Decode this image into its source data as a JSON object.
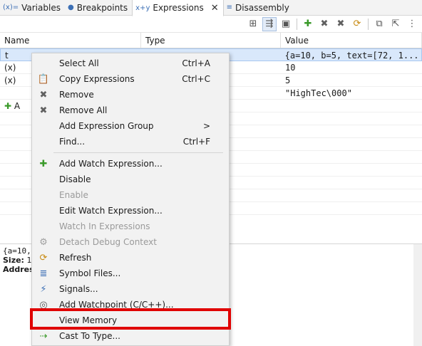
{
  "tabs": [
    {
      "label": "Variables",
      "icon": "(x)="
    },
    {
      "label": "Breakpoints",
      "icon": "●"
    },
    {
      "label": "Expressions",
      "icon": "x+y"
    },
    {
      "label": "Disassembly",
      "icon": "≡"
    }
  ],
  "columns": {
    "name": "Name",
    "type": "Type",
    "value": "Value"
  },
  "rows": [
    {
      "name": "t",
      "type": "",
      "value": "{a=10, b=5, text=[72, 1..."
    },
    {
      "name": "(x)",
      "type": "",
      "value": "10"
    },
    {
      "name": "(x)",
      "type": "",
      "value": "5"
    },
    {
      "name": "",
      "type": "",
      "value": "\"HighTec\\000\""
    },
    {
      "name": "A",
      "type": "",
      "value": ""
    }
  ],
  "detail": {
    "line1": "{a=10, b",
    "size_label": "Size:",
    "size_value": "16",
    "address_label": "Address"
  },
  "menu": {
    "group1": [
      {
        "label": "Select All",
        "shortcut": "Ctrl+A",
        "icon": "",
        "disabled": false
      },
      {
        "label": "Copy Expressions",
        "shortcut": "Ctrl+C",
        "icon": "copy-icon",
        "disabled": false
      },
      {
        "label": "Remove",
        "shortcut": "",
        "icon": "remove-icon",
        "disabled": false
      },
      {
        "label": "Remove All",
        "shortcut": "",
        "icon": "remove-all-icon",
        "disabled": false
      },
      {
        "label": "Add Expression Group",
        "shortcut": ">",
        "icon": "",
        "disabled": false
      },
      {
        "label": "Find...",
        "shortcut": "Ctrl+F",
        "icon": "",
        "disabled": false
      }
    ],
    "group2": [
      {
        "label": "Add Watch Expression...",
        "icon": "add-icon",
        "disabled": false
      },
      {
        "label": "Disable",
        "icon": "",
        "disabled": false
      },
      {
        "label": "Enable",
        "icon": "",
        "disabled": true
      },
      {
        "label": "Edit Watch Expression...",
        "icon": "",
        "disabled": false
      },
      {
        "label": "Watch In Expressions",
        "icon": "",
        "disabled": true
      },
      {
        "label": "Detach Debug Context",
        "icon": "gear-icon",
        "disabled": true
      },
      {
        "label": "Refresh",
        "icon": "refresh-icon",
        "disabled": false
      },
      {
        "label": "Symbol Files...",
        "icon": "symbol-files-icon",
        "disabled": false
      },
      {
        "label": "Signals...",
        "icon": "signals-icon",
        "disabled": false
      },
      {
        "label": "Add Watchpoint (C/C++)...",
        "icon": "watchpoint-icon",
        "disabled": false
      },
      {
        "label": "View Memory",
        "icon": "",
        "disabled": false
      },
      {
        "label": "Cast To Type...",
        "icon": "cast-icon",
        "disabled": false
      }
    ]
  },
  "highlight_color": "#e00000"
}
